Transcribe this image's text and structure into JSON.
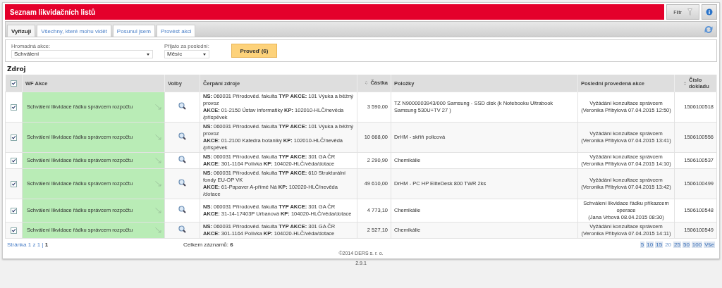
{
  "title": "Seznam likvidačních listů",
  "filter_button": "Filtr",
  "tabs": [
    {
      "label": "Vyřizuji",
      "selected": true
    },
    {
      "label": "Všechny, které mohu vidět",
      "selected": false
    },
    {
      "label": "Posunul jsem",
      "selected": false
    },
    {
      "label": "Provést akci",
      "selected": false
    }
  ],
  "bulk": {
    "action_label": "Hromadná akce:",
    "action_value": "Schválení",
    "period_label": "Přijato za poslední:",
    "period_value": "Měsíc",
    "submit": "Proveď (6)"
  },
  "section_title": "Zdroj",
  "table": {
    "select_all_checked": true,
    "columns": [
      "WF Akce",
      "Volby",
      "Čerpání zdroje",
      "Částka",
      "Položky",
      "Poslední provedená akce",
      "Číslo dokladu"
    ],
    "rows": [
      {
        "checked": true,
        "wf_action": "Schválení likvidace řádku správcem rozpočtu",
        "source_lines": [
          "**NS:** 060031 Přírodověd. fakulta **TYP AKCE:** 101 Výuka a běžný provoz",
          "**AKCE:** 01-2150 Ústav informatiky **KP:** 102010-HLČ/nevěda /příspěvek"
        ],
        "amount": "3 590,00",
        "items": "TZ N9000003943/000 Samsung - SSD disk (k Notebooku Ultrabook Samsung 530U+TV 27 )",
        "last_action": "Vyžádání konzultace správcem",
        "last_by": "(Veronika Přibylová 07.04.2015 12:50)",
        "doc": "1506100518"
      },
      {
        "checked": true,
        "wf_action": "Schválení likvidace řádku správcem rozpočtu",
        "source_lines": [
          "**NS:** 060031 Přírodověd. fakulta **TYP AKCE:** 101 Výuka a běžný provoz",
          "**AKCE:** 01-2100 Katedra botaniky **KP:** 102010-HLČ/nevěda /příspěvek"
        ],
        "amount": "10 668,00",
        "items": "DrHM - skříň policová",
        "last_action": "Vyžádání konzultace správcem",
        "last_by": "(Veronika Přibylová 07.04.2015 13:41)",
        "doc": "1506100556"
      },
      {
        "checked": true,
        "wf_action": "Schválení likvidace řádku správcem rozpočtu",
        "source_lines": [
          "**NS:** 060031 Přírodověd. fakulta **TYP AKCE:** 301 GA ČR",
          "**AKCE:** 301-1164 Polívka **KP:** 104020-HLČ/věda/dotace"
        ],
        "amount": "2 290,90",
        "items": "Chemikálie",
        "last_action": "Vyžádání konzultace správcem",
        "last_by": "(Veronika Přibylová 07.04.2015 14:10)",
        "doc": "1506100537"
      },
      {
        "checked": true,
        "wf_action": "Schválení likvidace řádku správcem rozpočtu",
        "source_lines": [
          "**NS:** 060031 Přírodověd. fakulta **TYP AKCE:** 610 Strukturální fondy EU-OP VK",
          "**AKCE:** 61-Papaver A-přímé Ná **KP:** 102020-HLČ/nevěda /dotace"
        ],
        "amount": "49 610,00",
        "items": "DrHM - PC HP EliteDesk 800 TWR 2ks",
        "last_action": "Vyžádání konzultace správcem",
        "last_by": "(Veronika Přibylová 07.04.2015 13:42)",
        "doc": "1506100499"
      },
      {
        "checked": true,
        "wf_action": "Schválení likvidace řádku správcem rozpočtu",
        "source_lines": [
          "**NS:** 060031 Přírodověd. fakulta **TYP AKCE:** 301 GA ČR",
          "**AKCE:** 31-14-17403P Urbanová **KP:** 104020-HLČ/věda/dotace"
        ],
        "amount": "4 773,10",
        "items": "Chemikálie",
        "last_action": "Schválení likvidace řádku příkazcem operace",
        "last_by": "(Jana Vrbová 08.04.2015 08:30)",
        "doc": "1506100548"
      },
      {
        "checked": true,
        "wf_action": "Schválení likvidace řádku správcem rozpočtu",
        "source_lines": [
          "**NS:** 060031 Přírodověd. fakulta **TYP AKCE:** 301 GA ČR",
          "**AKCE:** 301-1164 Polívka **KP:** 104020-HLČ/věda/dotace"
        ],
        "amount": "2 527,10",
        "items": "Chemikálie",
        "last_action": "Vyžádání konzultace správcem",
        "last_by": "(Veronika Přibylová 07.04.2015 14:11)",
        "doc": "1506100549"
      }
    ]
  },
  "pager": {
    "page_link": "Stránka 1 z 1 |",
    "current": "1",
    "total_label": "Celkem záznamů:",
    "total": "6",
    "sizes": [
      {
        "label": "5",
        "selected": false
      },
      {
        "label": "10",
        "selected": false
      },
      {
        "label": "15",
        "selected": false
      },
      {
        "label": "20",
        "selected": true
      },
      {
        "label": "25",
        "selected": false
      },
      {
        "label": "50",
        "selected": false
      },
      {
        "label": "100",
        "selected": false
      },
      {
        "label": "Vše",
        "selected": false
      }
    ]
  },
  "copyright": "©2014 DERS s. r. o.",
  "version": "2.9.1"
}
